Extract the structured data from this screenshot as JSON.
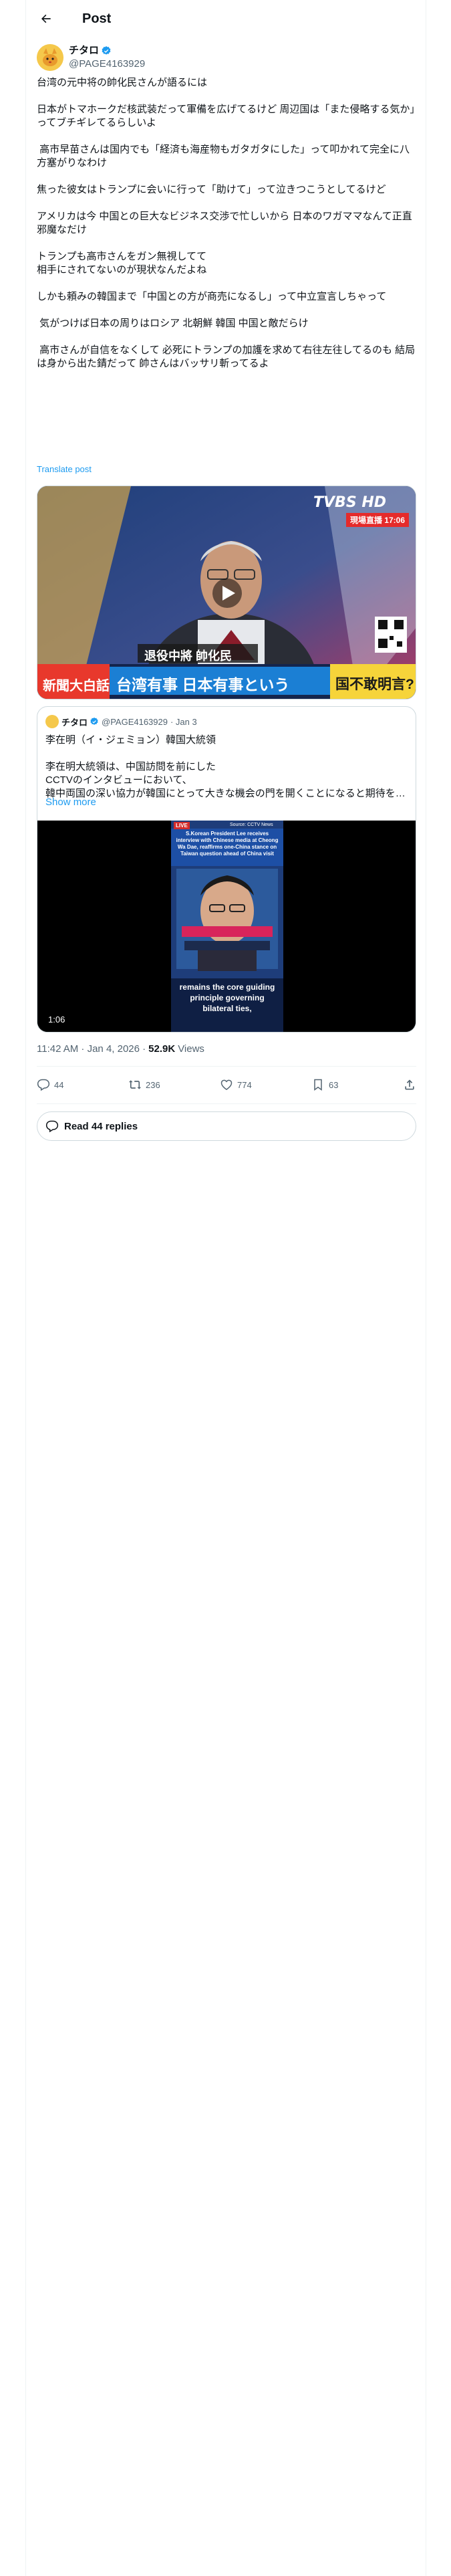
{
  "header": {
    "title": "Post"
  },
  "author": {
    "name": "チタロ",
    "handle": "@PAGE4163929"
  },
  "tweet": {
    "text": "台湾の元中将の帥化民さんが語るには\n\n日本がトマホークだ核武装だって軍備を広げてるけど 周辺国は「また侵略する気か」ってブチギレてるらしいよ\n\n 高市早苗さんは国内でも「経済も海産物もガタガタにした」って叩かれて完全に八方塞がりなわけ\n\n焦った彼女はトランプに会いに行って「助けて」って泣きつこうとしてるけど\n\nアメリカは今 中国との巨大なビジネス交渉で忙しいから 日本のワガママなんて正直邪魔なだけ\n\nトランプも高市さんをガン無視してて\n相手にされてないのが現状なんだよね\n\nしかも頼みの韓国まで「中国との方が商売になるし」って中立宣言しちゃって\n\n 気がつけば日本の周りはロシア 北朝鮮 韓国 中国と敵だらけ\n\n 高市さんが自信をなくして 必死にトランプの加護を求めて右往左往してるのも 結局は身から出た錆だって 帥さんはバッサリ斬ってるよ",
    "translate_label": "Translate post"
  },
  "media1": {
    "logo": "TVBS HD",
    "badge": "現場直播 17:06",
    "caption_small": "退役中將 帥化民",
    "banner_left": "新聞大白話",
    "banner_main": "台湾有事 日本有事という",
    "banner_end": "国不敢明言?"
  },
  "quote": {
    "name": "チタロ",
    "handle": "@PAGE4163929",
    "date": "· Jan 3",
    "text": "李在明（イ・ジェミョン）韓国大統領\n\n李在明大統領は、中国訪問を前にした\nCCTVのインタビューにおいて、\n韓中両国の深い協力が韓国にとって大きな機会の門を開くことになると期待を…",
    "show_more": "Show more",
    "video": {
      "tag": "LIVE",
      "source": "Source: CCTV News",
      "headline": "S.Korean President Lee receives interview with Chinese media at Cheong Wa Dae, reaffirms one-China stance on Taiwan question ahead of China visit",
      "sub1": "remains the core guiding",
      "sub2": "principle governing",
      "sub3": "bilateral ties,",
      "duration": "1:06"
    }
  },
  "meta": {
    "time": "11:42 AM · Jan 4, 2026 ·",
    "views_value": "52.9K",
    "views_label": "Views"
  },
  "actions": {
    "replies": "44",
    "reposts": "236",
    "likes": "774",
    "bookmarks": "63"
  },
  "read_replies": "Read 44 replies"
}
